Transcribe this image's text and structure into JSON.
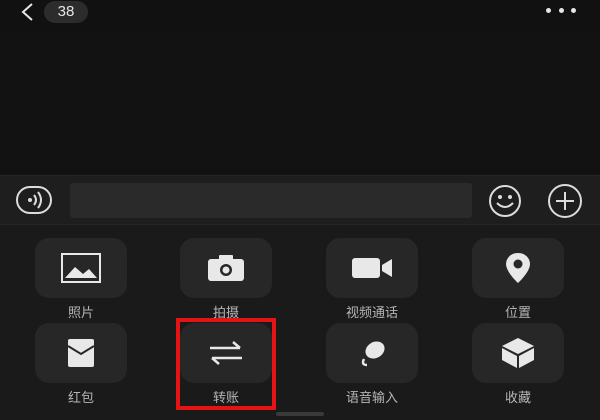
{
  "header": {
    "unread_count": "38"
  },
  "input_bar": {
    "placeholder": ""
  },
  "panel": {
    "items": [
      {
        "label": "照片",
        "icon": "photo-icon"
      },
      {
        "label": "拍摄",
        "icon": "camera-icon"
      },
      {
        "label": "视频通话",
        "icon": "video-call-icon"
      },
      {
        "label": "位置",
        "icon": "location-icon"
      },
      {
        "label": "红包",
        "icon": "red-packet-icon"
      },
      {
        "label": "转账",
        "icon": "transfer-icon"
      },
      {
        "label": "语音输入",
        "icon": "voice-input-icon"
      },
      {
        "label": "收藏",
        "icon": "favorites-icon"
      }
    ]
  },
  "colors": {
    "background": "#111111",
    "tile": "#272727",
    "highlight": "#e41414",
    "icon": "#e8e8e8"
  }
}
